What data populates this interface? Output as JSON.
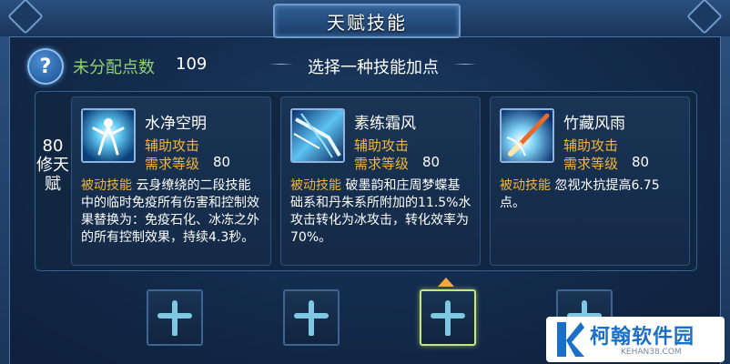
{
  "header": {
    "title": "天赋技能"
  },
  "info": {
    "help_glyph": "?",
    "points_label": "未分配点数",
    "points_value": "109",
    "select_hint": "选择一种技能加点"
  },
  "tier": {
    "label": "80修天赋"
  },
  "skills": [
    {
      "name": "水净空明",
      "type": "辅助攻击",
      "req_label": "需求等级",
      "req_value": "80",
      "desc_tag": "被动技能",
      "desc": "云身缭绕的二段技能中的临时免疫所有伤害和控制效果替换为：免疫石化、冰冻之外的所有控制效果，持续4.3秒。",
      "icon": "water-figure-icon"
    },
    {
      "name": "素练霜风",
      "type": "辅助攻击",
      "req_label": "需求等级",
      "req_value": "80",
      "desc_tag": "被动技能",
      "desc": "破墨韵和庄周梦蝶基础系和丹朱系所附加的11.5%水攻击转化为冰攻击，转化效率为70%。",
      "icon": "frost-wind-icon"
    },
    {
      "name": "竹藏风雨",
      "type": "辅助攻击",
      "req_label": "需求等级",
      "req_value": "80",
      "desc_tag": "被动技能",
      "desc": "忽视水抗提高6.75点。",
      "icon": "bamboo-brush-icon"
    }
  ],
  "slots": [
    {
      "icon": "plus-icon",
      "selected": false
    },
    {
      "icon": "plus-icon",
      "selected": false
    },
    {
      "icon": "plus-icon",
      "selected": true
    },
    {
      "icon": "plus-icon",
      "selected": false
    }
  ],
  "watermark": {
    "text": "柯翰软件园",
    "sub": "KEHAN38.COM"
  },
  "colors": {
    "accent_gold": "#f4b53a",
    "accent_green": "#8fd36f",
    "selected_border": "#c8e77a",
    "panel_bg": "#112641"
  }
}
